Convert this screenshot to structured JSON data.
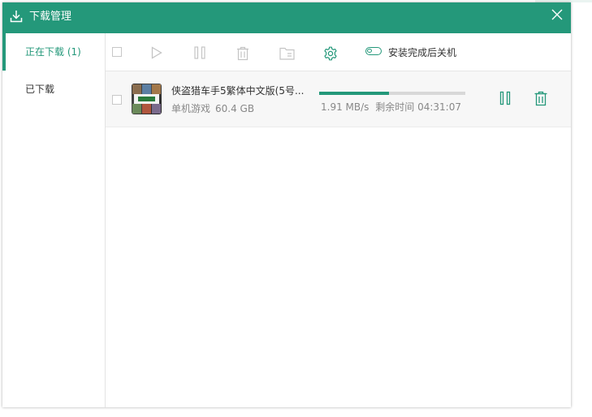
{
  "window": {
    "title": "下载管理",
    "title_icon": "download-icon",
    "close_icon": "close-icon"
  },
  "colors": {
    "accent": "#24987a",
    "progress_track": "#d8d8d8",
    "row_background": "#f7f7f7"
  },
  "sidebar": {
    "items": [
      {
        "label": "正在下载 (1)",
        "active": true
      },
      {
        "label": "已下载",
        "active": false
      }
    ]
  },
  "toolbar": {
    "icons": [
      "select-all-checkbox",
      "play-icon",
      "pause-icon",
      "trash-icon",
      "folder-icon",
      "gear-icon"
    ],
    "shutdown_toggle": {
      "label": "安装完成后关机",
      "on": false
    }
  },
  "downloads": [
    {
      "name": "侠盗猎车手5繁体中文版(5号...",
      "category": "单机游戏",
      "size": "60.4 GB",
      "speed": "1.91 MB/s",
      "remaining_label": "剩余时间",
      "remaining_time": "04:31:07",
      "progress": 0.48,
      "thumbnail": "gta-v-cover"
    }
  ]
}
